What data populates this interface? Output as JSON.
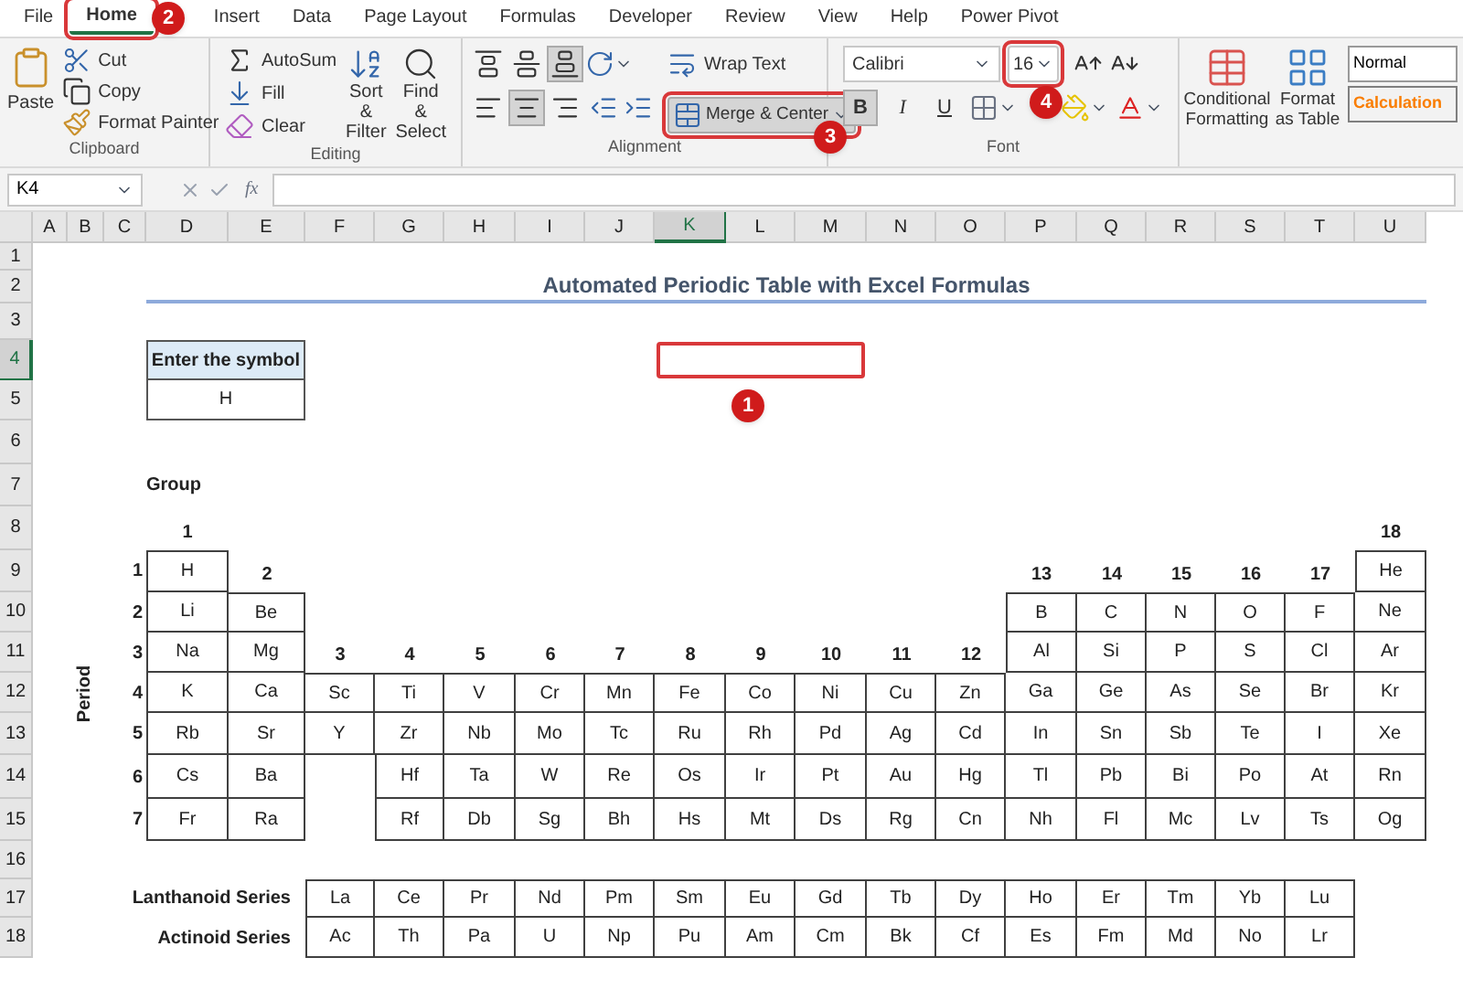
{
  "ribbon": {
    "tabs": [
      {
        "label": "File",
        "selected": false
      },
      {
        "label": "Home",
        "selected": true
      },
      {
        "label": "Insert",
        "selected": false
      },
      {
        "label": "Data",
        "selected": false
      },
      {
        "label": "Page Layout",
        "selected": false
      },
      {
        "label": "Formulas",
        "selected": false
      },
      {
        "label": "Developer",
        "selected": false
      },
      {
        "label": "Review",
        "selected": false
      },
      {
        "label": "View",
        "selected": false
      },
      {
        "label": "Help",
        "selected": false
      },
      {
        "label": "Power Pivot",
        "selected": false
      }
    ],
    "clipboard": {
      "label": "Clipboard",
      "paste": "Paste",
      "cut": "Cut",
      "copy": "Copy",
      "painter": "Format Painter"
    },
    "editing": {
      "label": "Editing",
      "autosum": "AutoSum",
      "fill": "Fill",
      "clear": "Clear",
      "sort": "Sort & Filter",
      "find": "Find & Select"
    },
    "alignment": {
      "label": "Alignment",
      "vertical": [
        {
          "selected": false
        },
        {
          "selected": false
        },
        {
          "selected": true
        }
      ],
      "horizontal": [
        {
          "selected": false
        },
        {
          "selected": true
        },
        {
          "selected": false
        }
      ],
      "wrap_text": "Wrap Text",
      "merge": {
        "label": "Merge & Center",
        "selected": true
      }
    },
    "font": {
      "label": "Font",
      "name": "Calibri",
      "size": "16",
      "format_buttons": [
        {
          "text": "B",
          "selected": true
        },
        {
          "text": "I",
          "selected": false
        },
        {
          "text": "U",
          "selected": false
        }
      ]
    },
    "styles": {
      "conditional": "Conditional Formatting",
      "format_table": "Format as Table",
      "cell_styles": [
        {
          "text": "Normal",
          "kind": "normal"
        },
        {
          "text": "Calculation",
          "kind": "calculation"
        }
      ]
    }
  },
  "formula_bar": {
    "name_box": "K4",
    "function_symbol": "fx"
  },
  "sheet": {
    "column_headers": [
      "A",
      "B",
      "C",
      "D",
      "E",
      "F",
      "G",
      "H",
      "I",
      "J",
      "K",
      "L",
      "M",
      "N",
      "O",
      "P",
      "Q",
      "R",
      "S",
      "T",
      "U"
    ],
    "row_headers": [
      "1",
      "2",
      "3",
      "4",
      "5",
      "6",
      "7",
      "8",
      "9",
      "10",
      "11",
      "12",
      "13",
      "14",
      "15",
      "16",
      "17",
      "18"
    ],
    "title": "Automated Periodic Table with Excel Formulas",
    "symbol_input": {
      "header": "Enter the symbol",
      "value": "H"
    },
    "group_label": "Group",
    "period_label": "Period",
    "groups": [
      "1",
      "2",
      "3",
      "4",
      "5",
      "6",
      "7",
      "8",
      "9",
      "10",
      "11",
      "12",
      "13",
      "14",
      "15",
      "16",
      "17",
      "18"
    ],
    "periods": [
      {
        "number": "1",
        "left": [
          "H"
        ],
        "right": [
          "He"
        ]
      },
      {
        "number": "2",
        "left": [
          "Li",
          "Be"
        ],
        "right": [
          "B",
          "C",
          "N",
          "O",
          "F",
          "Ne"
        ]
      },
      {
        "number": "3",
        "left": [
          "Na",
          "Mg"
        ],
        "right": [
          "Al",
          "Si",
          "P",
          "S",
          "Cl",
          "Ar"
        ]
      },
      {
        "number": "4",
        "left": [
          "K",
          "Ca",
          "Sc",
          "Ti",
          "V",
          "Cr",
          "Mn",
          "Fe",
          "Co",
          "Ni",
          "Cu",
          "Zn",
          "Ga",
          "Ge",
          "As",
          "Se",
          "Br",
          "Kr"
        ]
      },
      {
        "number": "5",
        "left": [
          "Rb",
          "Sr",
          "Y",
          "Zr",
          "Nb",
          "Mo",
          "Tc",
          "Ru",
          "Rh",
          "Pd",
          "Ag",
          "Cd",
          "In",
          "Sn",
          "Sb",
          "Te",
          "I",
          "Xe"
        ]
      },
      {
        "number": "6",
        "left": [
          "Cs",
          "Ba"
        ],
        "right": [
          "Hf",
          "Ta",
          "W",
          "Re",
          "Os",
          "Ir",
          "Pt",
          "Au",
          "Hg",
          "Tl",
          "Pb",
          "Bi",
          "Po",
          "At",
          "Rn"
        ]
      },
      {
        "number": "7",
        "left": [
          "Fr",
          "Ra"
        ],
        "right": [
          "Rf",
          "Db",
          "Sg",
          "Bh",
          "Hs",
          "Mt",
          "Ds",
          "Rg",
          "Cn",
          "Nh",
          "Fl",
          "Mc",
          "Lv",
          "Ts",
          "Og"
        ]
      }
    ],
    "series": [
      {
        "label": "Lanthanoid Series",
        "elements": [
          "La",
          "Ce",
          "Pr",
          "Nd",
          "Pm",
          "Sm",
          "Eu",
          "Gd",
          "Tb",
          "Dy",
          "Ho",
          "Er",
          "Tm",
          "Yb",
          "Lu"
        ]
      },
      {
        "label": "Actinoid Series",
        "elements": [
          "Ac",
          "Th",
          "Pa",
          "U",
          "Np",
          "Pu",
          "Am",
          "Cm",
          "Bk",
          "Cf",
          "Es",
          "Fm",
          "Md",
          "No",
          "Lr"
        ]
      }
    ]
  },
  "callouts": [
    {
      "label": "1"
    },
    {
      "label": "2"
    },
    {
      "label": "3"
    },
    {
      "label": "4"
    }
  ]
}
